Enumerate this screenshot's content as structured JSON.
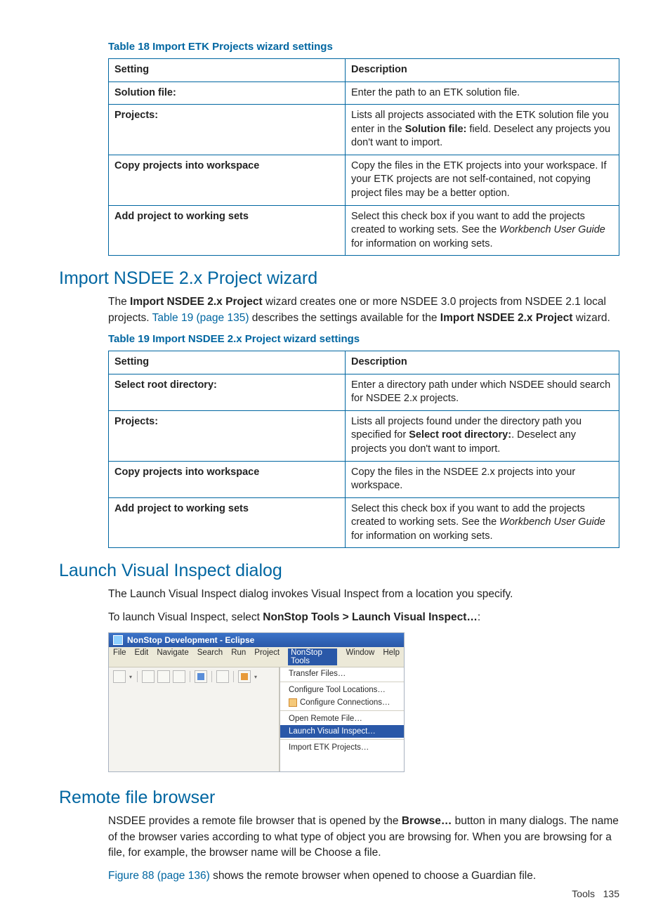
{
  "table18": {
    "caption": "Table 18 Import ETK Projects wizard settings",
    "head": {
      "c1": "Setting",
      "c2": "Description"
    },
    "rows": [
      {
        "c1": "Solution file:",
        "c2": "Enter the path to an ETK solution file."
      },
      {
        "c1": "Projects:",
        "c2_pre": "Lists all projects associated with the ETK solution file you enter in the ",
        "c2_bold": "Solution file:",
        "c2_post": " field. Deselect any projects you don't want to import."
      },
      {
        "c1": "Copy projects into workspace",
        "c2": "Copy the files in the ETK projects into your workspace. If your ETK projects are not self-contained, not copying project files may be a better option."
      },
      {
        "c1": "Add project to working sets",
        "c2_pre": "Select this check box if you want to add the projects created to working sets. See the ",
        "c2_italic": "Workbench User Guide",
        "c2_post": " for information on working sets."
      }
    ]
  },
  "sec_import": {
    "heading": "Import NSDEE 2.x Project wizard",
    "para_pre": "The ",
    "para_bold1": "Import NSDEE 2.x Project",
    "para_mid1": " wizard creates one or more NSDEE 3.0 projects from NSDEE 2.1 local projects. ",
    "para_link": "Table 19 (page 135)",
    "para_mid2": " describes the settings available for the ",
    "para_bold2": "Import NSDEE 2.x Project",
    "para_post": " wizard."
  },
  "table19": {
    "caption": "Table 19 Import NSDEE 2.x Project wizard settings",
    "head": {
      "c1": "Setting",
      "c2": "Description"
    },
    "rows": [
      {
        "c1": "Select root directory:",
        "c2": "Enter a directory path under which NSDEE should search for NSDEE 2.x projects."
      },
      {
        "c1": "Projects:",
        "c2_pre": "Lists all projects found under the directory path you specified for ",
        "c2_bold": "Select root directory:",
        "c2_post": ". Deselect any projects you don't want to import."
      },
      {
        "c1": "Copy projects into workspace",
        "c2": "Copy the files in the NSDEE 2.x projects into your workspace."
      },
      {
        "c1": "Add project to working sets",
        "c2_pre": "Select this check box if you want to add the projects created to working sets. See the ",
        "c2_italic": "Workbench User Guide",
        "c2_post": " for information on working sets."
      }
    ]
  },
  "sec_launch": {
    "heading": "Launch Visual Inspect dialog",
    "para1": "The Launch Visual Inspect dialog invokes Visual Inspect from a location you specify.",
    "para2_pre": "To launch Visual Inspect, select ",
    "para2_bold": "NonStop Tools > Launch Visual Inspect…",
    "para2_post": ":"
  },
  "eclipse": {
    "title": "NonStop Development - Eclipse",
    "menus": [
      "File",
      "Edit",
      "Navigate",
      "Search",
      "Run",
      "Project",
      "NonStop Tools",
      "Window",
      "Help"
    ],
    "dropdown": {
      "g1": [
        "Transfer Files…"
      ],
      "g2": [
        "Configure Tool Locations…",
        "Configure Connections…"
      ],
      "g3": [
        "Open Remote File…",
        "Launch Visual Inspect…"
      ],
      "g4": [
        "Import ETK Projects…"
      ]
    },
    "selected_menu_index": 6,
    "selected_item": "Launch Visual Inspect…"
  },
  "sec_remote": {
    "heading": "Remote file browser",
    "para1_pre": "NSDEE provides a remote file browser that is opened by the ",
    "para1_bold": "Browse…",
    "para1_post": " button in many dialogs. The name of the browser varies according to what type of object you are browsing for. When you are browsing for a file, for example, the browser name will be Choose a file.",
    "para2_link": "Figure 88 (page 136)",
    "para2_post": " shows the remote browser when opened to choose a Guardian file."
  },
  "footer": {
    "section": "Tools",
    "page": "135"
  }
}
